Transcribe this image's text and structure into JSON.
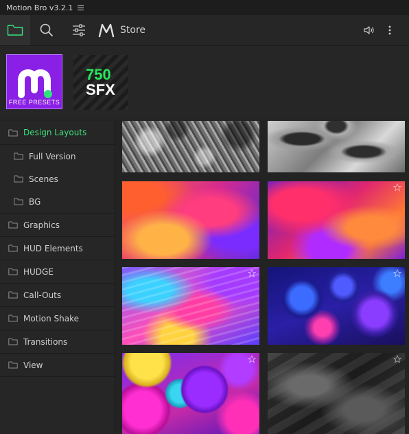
{
  "app": {
    "title": "Motion Bro v3.2.1"
  },
  "toolbar": {
    "store_label": "Store"
  },
  "banners": {
    "free_presets_label": "FREE PRESETS",
    "sfx_number": "750",
    "sfx_word": "SFX"
  },
  "sidebar": {
    "items": [
      {
        "label": "Design Layouts",
        "active": true
      },
      {
        "label": "Full Version"
      },
      {
        "label": "Scenes"
      },
      {
        "label": "BG"
      },
      {
        "label": "Graphics"
      },
      {
        "label": "HUD Elements"
      },
      {
        "label": "HUDGE"
      },
      {
        "label": "Call-Outs"
      },
      {
        "label": "Motion Shake"
      },
      {
        "label": "Transitions"
      },
      {
        "label": "View"
      }
    ]
  },
  "colors": {
    "accent": "#3be27c",
    "free_presets_bg": "#8a1fe6",
    "sfx_green": "#27e65a"
  },
  "icons": [
    "folder-icon",
    "search-icon",
    "filter-icon",
    "motion-bro-logo-icon",
    "speaker-icon",
    "more-vertical-icon",
    "star-icon"
  ]
}
